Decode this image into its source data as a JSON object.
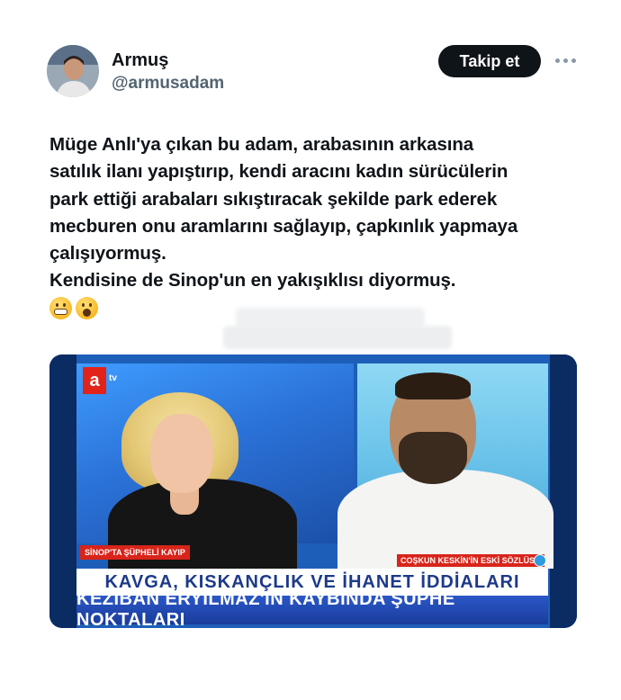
{
  "tweet": {
    "author_name": "Armuş",
    "author_handle": "@armusadam",
    "follow_label": "Takip et",
    "text": "Müge Anlı'ya çıkan bu adam, arabasının arkasına\nsatılık ilanı yapıştırıp, kendi aracını kadın sürücülerin\npark ettiği arabaları sıkıştıracak şekilde park ederek\nmecburen onu aramlarını sağlayıp, çapkınlık yapmaya\nçalışıyormuş.\nKendisine de Sinop'un en yakışıklısı diyormuş.",
    "emojis": [
      "grimacing-face",
      "face-with-open-mouth"
    ]
  },
  "media": {
    "channel_logo": "a",
    "channel_suffix": "tv",
    "lower_third_left": "SİNOP'TA ŞÜPHELİ KAYIP",
    "lower_third_right": "COŞKUN KESKİN'İN ESKİ SÖZLÜSÜ",
    "headline_top": "KAVGA, KISKANÇLIK VE İHANET İDDİALARI",
    "headline_bottom": "KEZİBAN ERYILMAZ'IN KAYBINDA ŞÜPHE NOKTALARI"
  }
}
